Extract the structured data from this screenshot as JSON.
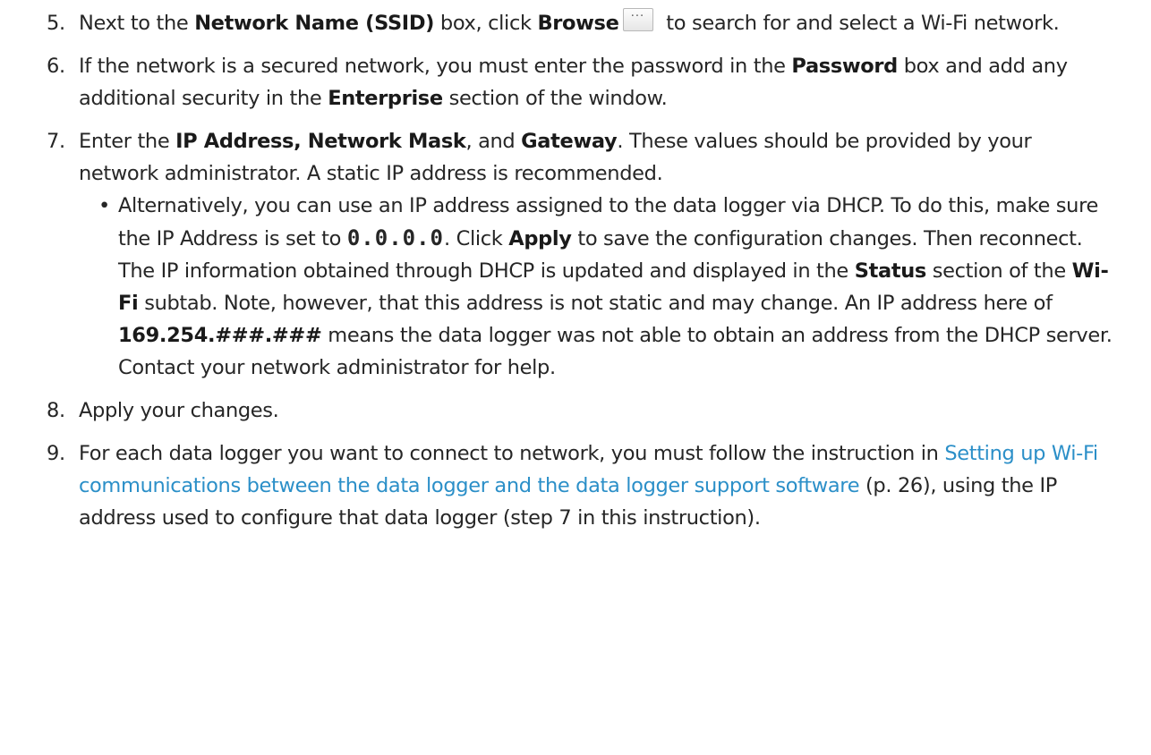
{
  "steps": [
    {
      "num": "5.",
      "t1": "Next to the ",
      "b1": "Network Name (SSID)",
      "t2": " box, click ",
      "b2": "Browse",
      "icon_glyph": "···",
      "t3": " to search for and select a Wi-Fi network."
    },
    {
      "num": "6.",
      "t1": "If the network is a secured network, you must enter the password in the ",
      "b1": "Password",
      "t2": " box and add any additional security in the ",
      "b2": "Enterprise",
      "t3": " section of the window."
    },
    {
      "num": "7.",
      "t1": "Enter the ",
      "b1": "IP Address, Network Mask",
      "t2": ", and ",
      "b2": "Gateway",
      "t3": ". These values should be provided by your network administrator. A static IP address is recommended.",
      "sub": {
        "bullet": "•",
        "t1": "Alternatively, you can use an IP address assigned to the data logger via DHCP. To do this, make sure the IP Address is set to ",
        "code": "0.0.0.0",
        "t2": ". Click ",
        "b1": "Apply",
        "t3": " to save the configuration changes. Then reconnect. The IP information obtained through DHCP is updated and displayed in the ",
        "b2": "Status",
        "t4": " section of the ",
        "b3": "Wi-Fi",
        "t5": " subtab. Note, however, that this address is not static and may change. An IP address here of ",
        "b4": "169.254.###.###",
        "t6": " means the data logger was not able to obtain an address from the DHCP server. Contact your network administrator for help."
      }
    },
    {
      "num": "8.",
      "t1": "Apply your changes."
    },
    {
      "num": "9.",
      "t1": "For each data logger you want to connect to network, you must follow the instruction in ",
      "link": "Setting up Wi-Fi communications between the data logger and the data logger support software",
      "t2": " (p. 26), using the IP address used to configure that data logger (step 7 in this instruction)."
    }
  ]
}
